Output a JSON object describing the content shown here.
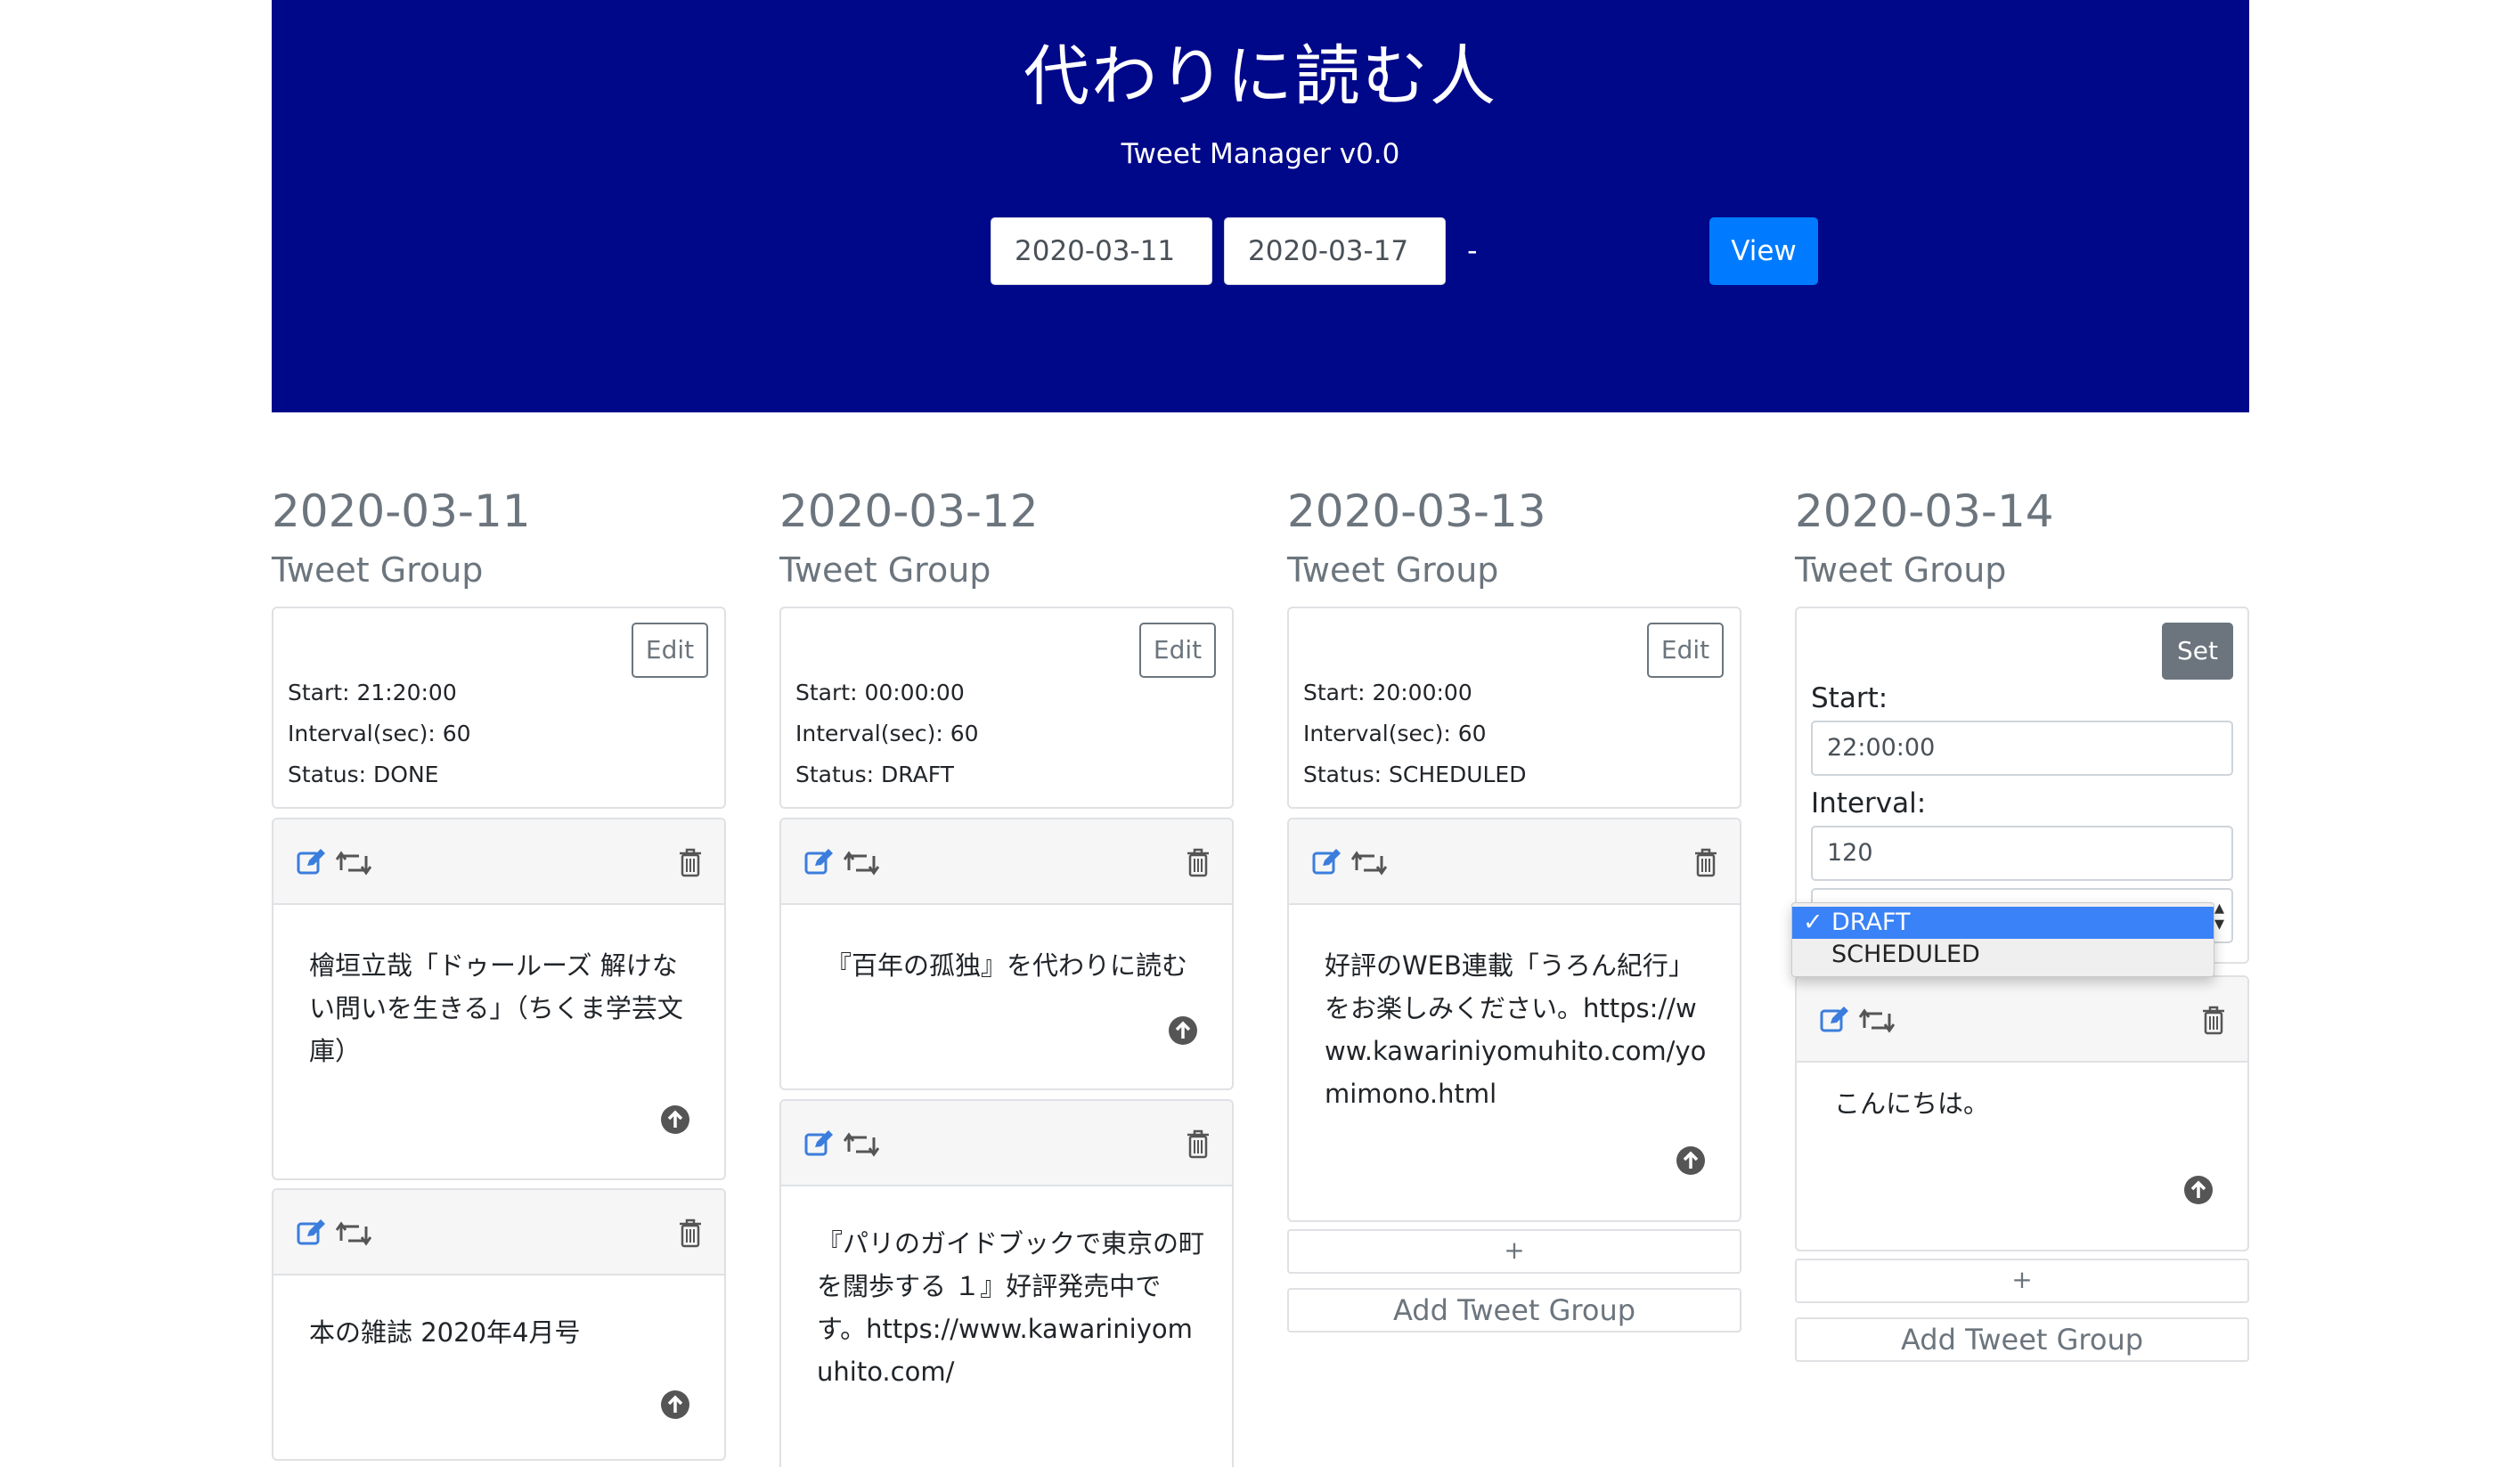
{
  "header": {
    "title": "代わりに読む人",
    "subtitle": "Tweet Manager v0.0",
    "start_date": "2020-03-11",
    "separator": "-",
    "end_date": "2020-03-17",
    "view_label": "View"
  },
  "days": [
    {
      "date": "2020-03-11",
      "group_label": "Tweet Group",
      "edit_label": "Edit",
      "start": "Start: 21:20:00",
      "interval": "Interval(sec): 60",
      "status": "Status: DONE",
      "tweets": [
        {
          "text": "檜垣立哉「ドゥールーズ 解けない問いを生きる」（ちくま学芸文庫）"
        },
        {
          "text": "本の雑誌 2020年4月号"
        }
      ]
    },
    {
      "date": "2020-03-12",
      "group_label": "Tweet Group",
      "edit_label": "Edit",
      "start": "Start: 00:00:00",
      "interval": "Interval(sec): 60",
      "status": "Status: DRAFT",
      "tweets": [
        {
          "text": "『百年の孤独』を代わりに読む"
        },
        {
          "text": "『パリのガイドブックで東京の町を闊歩する １』好評発売中です。https://www.kawariniyomuhito.com/"
        }
      ]
    },
    {
      "date": "2020-03-13",
      "group_label": "Tweet Group",
      "edit_label": "Edit",
      "start": "Start: 20:00:00",
      "interval": "Interval(sec): 60",
      "status": "Status: SCHEDULED",
      "tweets": [
        {
          "text": "好評のWEB連載「うろん紀行」をお楽しみください。https://www.kawariniyomuhito.com/yomimono.html"
        }
      ],
      "plus_label": "+",
      "add_group_label": "Add Tweet Group"
    },
    {
      "date": "2020-03-14",
      "group_label": "Tweet Group",
      "set_label": "Set",
      "start_label": "Start:",
      "start_value": "22:00:00",
      "interval_label": "Interval:",
      "interval_value": "120",
      "status_options": [
        "DRAFT",
        "SCHEDULED"
      ],
      "status_selected": "DRAFT",
      "tweets": [
        {
          "text": "こんにちは。"
        }
      ],
      "plus_label": "+",
      "add_group_label": "Add Tweet Group"
    }
  ],
  "colors": {
    "header_bg": "#00088a",
    "primary": "#007bff",
    "muted": "#6c757d",
    "icon_blue": "#3b7ddd",
    "select_highlight": "#3a82f7"
  },
  "icons": [
    "edit-icon",
    "retweet-icon",
    "trash-icon",
    "arrow-up-circle-icon",
    "checkmark-icon",
    "select-arrows-icon"
  ]
}
